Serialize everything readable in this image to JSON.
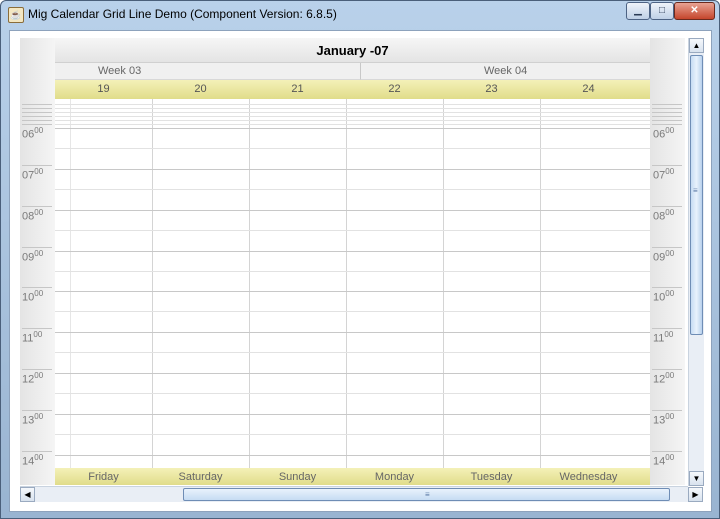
{
  "window": {
    "title": "Mig Calendar Grid Line Demo (Component Version: 6.8.5)",
    "app_icon": "java-cup-icon",
    "min_glyph": "▁",
    "max_glyph": "□",
    "close_glyph": "✕"
  },
  "calendar": {
    "month_title": "January -07",
    "weeks": [
      {
        "label": "Week 03"
      },
      {
        "label": "Week 04"
      }
    ],
    "days": [
      {
        "num": "19",
        "name": "Friday"
      },
      {
        "num": "20",
        "name": "Saturday"
      },
      {
        "num": "21",
        "name": "Sunday"
      },
      {
        "num": "22",
        "name": "Monday"
      },
      {
        "num": "23",
        "name": "Tuesday"
      },
      {
        "num": "24",
        "name": "Wednesday"
      }
    ],
    "hours": [
      {
        "h": "06",
        "m": "00"
      },
      {
        "h": "07",
        "m": "00"
      },
      {
        "h": "08",
        "m": "00"
      },
      {
        "h": "09",
        "m": "00"
      },
      {
        "h": "10",
        "m": "00"
      },
      {
        "h": "11",
        "m": "00"
      },
      {
        "h": "12",
        "m": "00"
      },
      {
        "h": "13",
        "m": "00"
      },
      {
        "h": "14",
        "m": "00"
      }
    ],
    "header_color": "#ece9a8"
  },
  "scrollbars": {
    "up_arrow": "▲",
    "down_arrow": "▼",
    "left_arrow": "◀",
    "right_arrow": "▶",
    "grip": "≡"
  }
}
